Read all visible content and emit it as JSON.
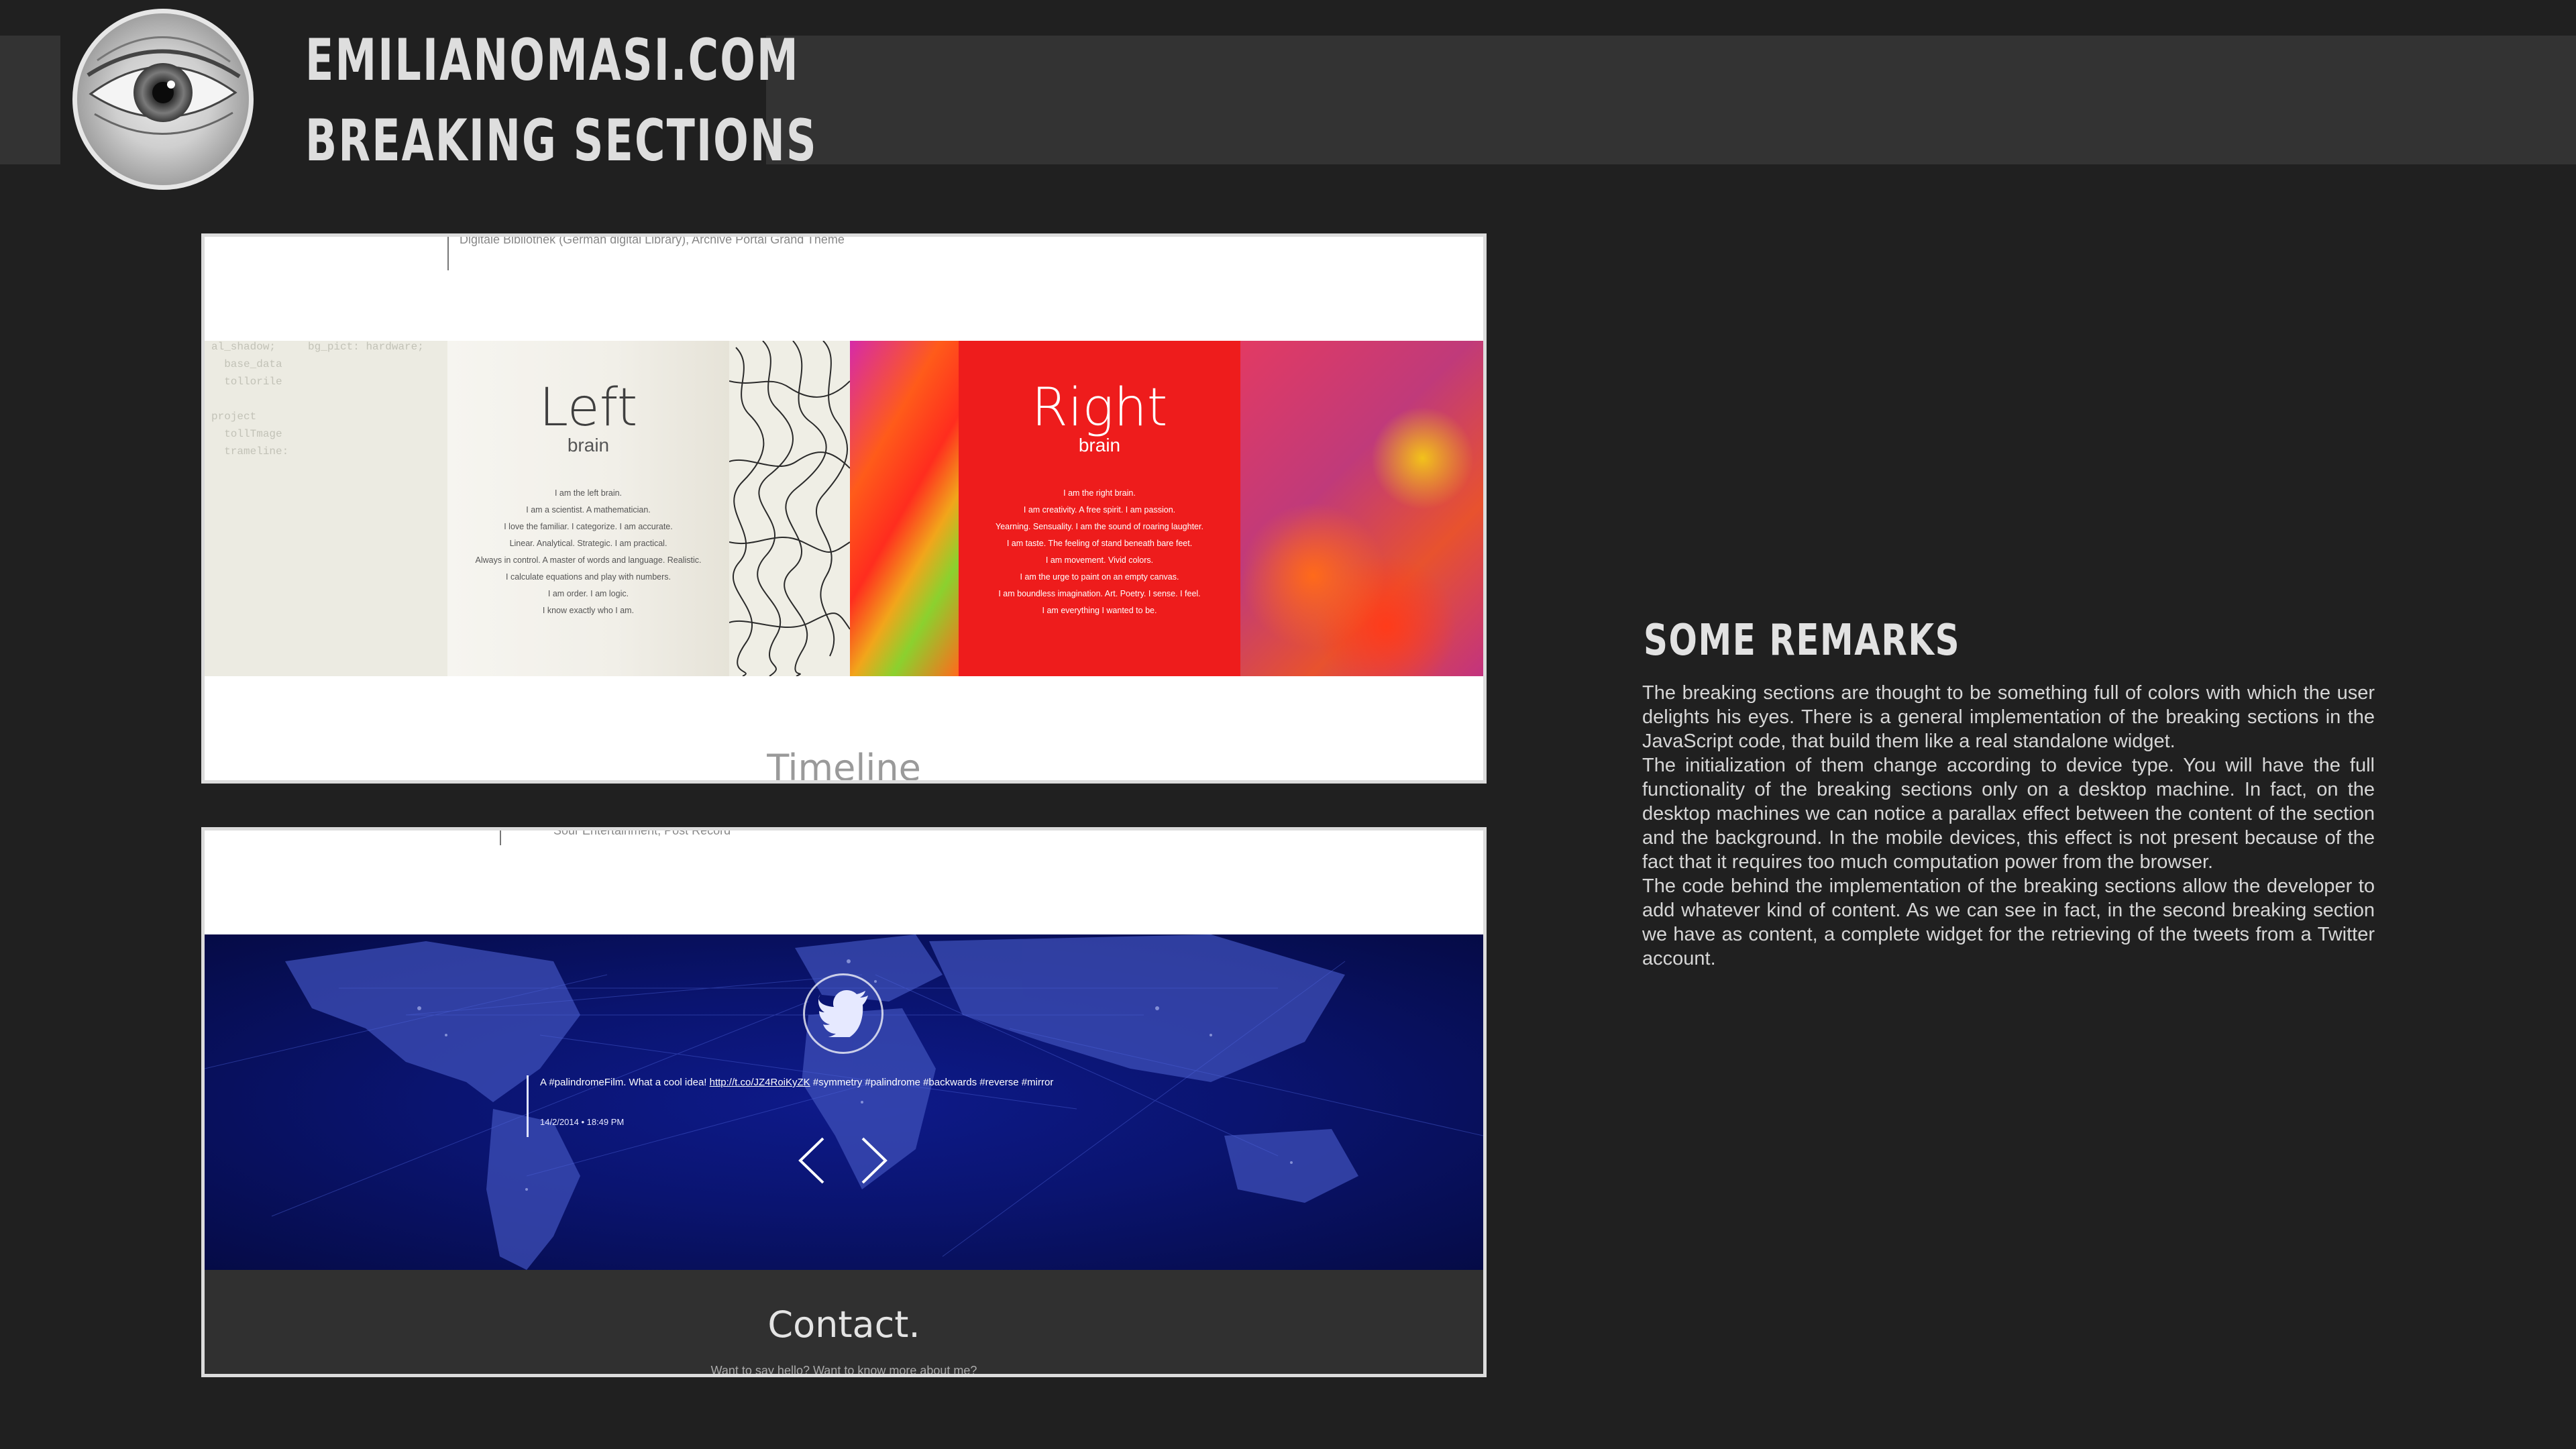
{
  "header": {
    "title": "EMILIANOMASI.COM",
    "subtitle": "BREAKING SECTIONS",
    "avatar_icon": "eye-photo"
  },
  "shot_brain": {
    "clipped_header_text": "Digitale Bibliothek (German digital Library), Archive Portal Grand Theme",
    "code_lines": [
      "al_shadow;     bg_pict: hardware;",
      "  base_data",
      "  tollorile",
      "",
      "project",
      "  tollTmage",
      "  trameline:"
    ],
    "left": {
      "title": "Left",
      "subtitle": "brain",
      "lines": [
        "I am the left brain.",
        "I am a scientist. A mathematician.",
        "I love the familiar. I categorize. I am accurate.",
        "Linear. Analytical. Strategic. I am practical.",
        "Always in control. A master of words and language. Realistic.",
        "I calculate equations and play with numbers.",
        "I am order. I am logic.",
        "I know exactly who I am."
      ]
    },
    "right": {
      "title": "Right",
      "subtitle": "brain",
      "lines": [
        "I am the right brain.",
        "I am creativity. A free spirit. I am passion.",
        "Yearning. Sensuality. I am the sound of roaring laughter.",
        "I am taste. The feeling of stand beneath bare feet.",
        "I am movement. Vivid colors.",
        "I am the urge to paint on an empty canvas.",
        "I am boundless imagination. Art. Poetry. I sense. I feel.",
        "I am everything I wanted to be."
      ]
    },
    "next_heading": "Timeline"
  },
  "shot_twitter": {
    "clipped_header_text": "Sour Entertainment, Post Record",
    "bird_icon": "twitter-bird-icon",
    "tweet": {
      "text_before": "A #palindromeFilm. What a cool idea! ",
      "link": "http://t.co/JZ4RoiKyZK",
      "text_after": " #symmetry #palindrome #backwards #reverse #mirror",
      "date": "14/2/2014 • 18:49 PM"
    },
    "next_heading": "Contact.",
    "contact_sub": "Want to say hello? Want to know more about me?"
  },
  "remarks": {
    "title": "SOME REMARKS",
    "paragraphs": [
      "The breaking sections are thought to be something full of colors with which the user delights his eyes. There is a general implementation of the breaking sections in the JavaScript code, that build them like a real standalone widget.",
      "The initialization of them change according to device type. You will have the full functionality of the breaking sections only on a desktop machine. In fact, on the desktop machines we can notice a parallax effect between the content of the section and the background. In the mobile devices, this effect is not present because of the fact that it requires too much computation power from the browser.",
      "The code behind the implementation of the breaking sections allow the developer to add whatever kind of content. As we can see in fact, in the second breaking section we have as content, a complete widget for the retrieving of the tweets from a Twitter account."
    ]
  },
  "colors": {
    "page_bg": "#202020",
    "header_band": "#333333",
    "right_brain_red": "#ee1c1c",
    "world_blue": "#0a1470",
    "contact_bg": "#303030"
  }
}
